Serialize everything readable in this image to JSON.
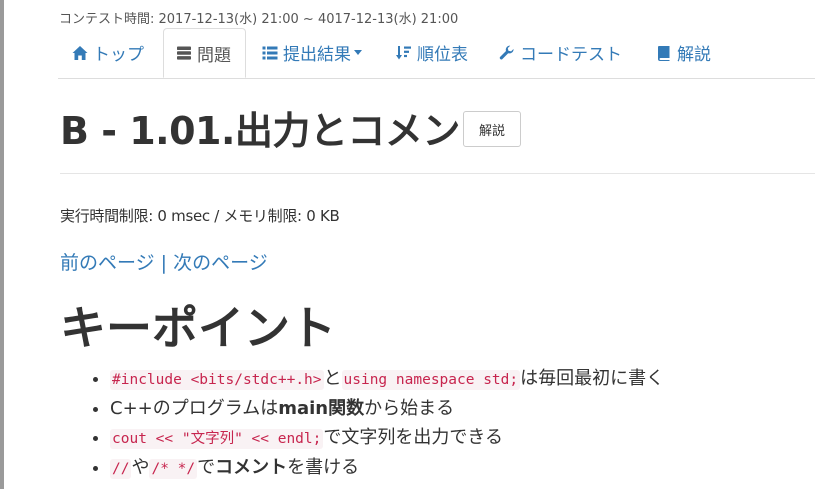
{
  "contest_time": "コンテスト時間: 2017-12-13(水) 21:00 ~ 4017-12-13(水) 21:00",
  "nav": {
    "top": "トップ",
    "tasks": "問題",
    "submissions": "提出結果",
    "standings": "順位表",
    "custom_test": "コードテスト",
    "editorial": "解説"
  },
  "task": {
    "title": "B - 1.01.出力とコメント",
    "editorial_button": "解説",
    "limits": "実行時間制限: 0 msec / メモリ制限: 0 KB"
  },
  "pager": {
    "prev": "前のページ",
    "separator": "|",
    "next": "次のページ"
  },
  "section_heading": "キーポイント",
  "key_points": {
    "p1": {
      "code1": "#include <bits/stdc++.h>",
      "text1": "と",
      "code2": "using namespace std;",
      "text2": "は毎回最初に書く"
    },
    "p2": {
      "text1": "C++のプログラムは",
      "bold": "main関数",
      "text2": "から始まる"
    },
    "p3": {
      "code1": "cout << \"文字列\" << endl;",
      "text1": "で文字列を出力できる"
    },
    "p4": {
      "code1": "//",
      "text1": "や",
      "code2": "/* */",
      "text2": "で",
      "bold": "コメント",
      "text3": "を書ける"
    }
  },
  "colors": {
    "link": "#337ab7",
    "code_text": "#c7254e",
    "code_bg": "#f9f2f4",
    "text": "#333333"
  }
}
